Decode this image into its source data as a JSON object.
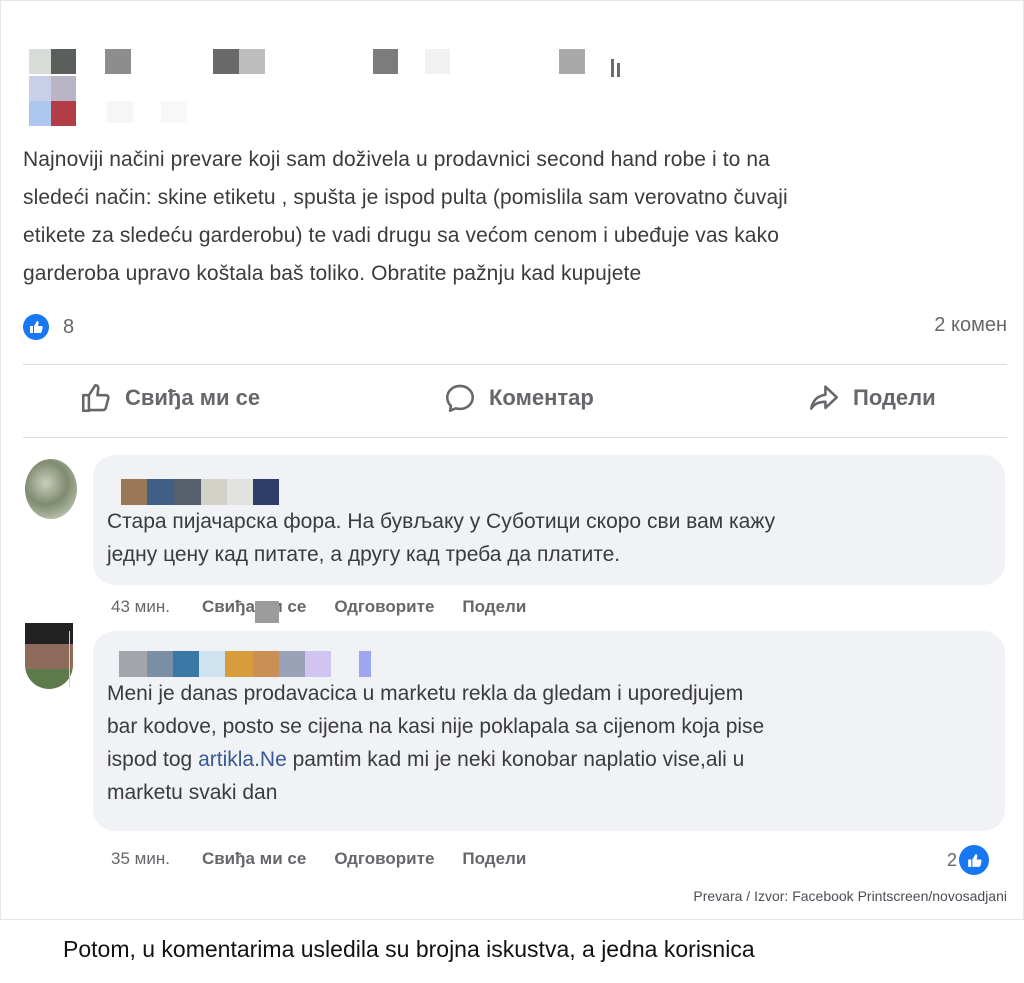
{
  "post": {
    "lines": [
      "Najnoviji načini prevare koji sam doživela u prodavnici second hand robe i to na",
      "sledeći način: skine etiketu , spušta je ispod pulta (pomislila sam verovatno čuvaji",
      "etikete za sledeću garderobu) te vadi drugu sa većom cenom i ubeđuje vas kako",
      "garderoba upravo koštala baš toliko. Obratite pažnju kad kupujete"
    ],
    "reaction_count": "8",
    "comment_count": "2 комен"
  },
  "actions": {
    "like": "Свиђа ми се",
    "comment": "Коментар",
    "share": "Подели"
  },
  "comments": [
    {
      "lines": [
        "Стара пијачарска фора. На бувљаку у Суботици скоро сви вам кажу",
        "једну цену кад питате, а другу кад треба да платите."
      ],
      "time": "43 мин.",
      "like": "Свиђа ми се",
      "reply": "Одговорите",
      "share": "Подели"
    },
    {
      "lines_plain": [
        "Meni je danas prodavacica u marketu rekla da gledam i uporedjujem",
        "bar kodove, posto se cijena na kasi nije poklapala sa cijenom koja pise"
      ],
      "line3_prefix": "ispod tog ",
      "line3_link": "artikla.Ne",
      "line3_suffix": " pamtim kad mi je neki konobar naplatio vise,ali u",
      "line4": "marketu svaki dan",
      "time": "35 мин.",
      "like": "Свиђа ми се",
      "reply": "Одговорите",
      "share": "Подели",
      "reaction_count": "2"
    }
  ],
  "caption": "Prevara / Izvor: Facebook Printscreen/novosadjani",
  "article_text": "Potom, u komentarima usledila su brojna iskustva, a jedna korisnica",
  "colors": {
    "facebook_blue": "#1877f2",
    "bubble_bg": "#f0f2f5",
    "link": "#385898",
    "muted_text": "#65676b"
  }
}
